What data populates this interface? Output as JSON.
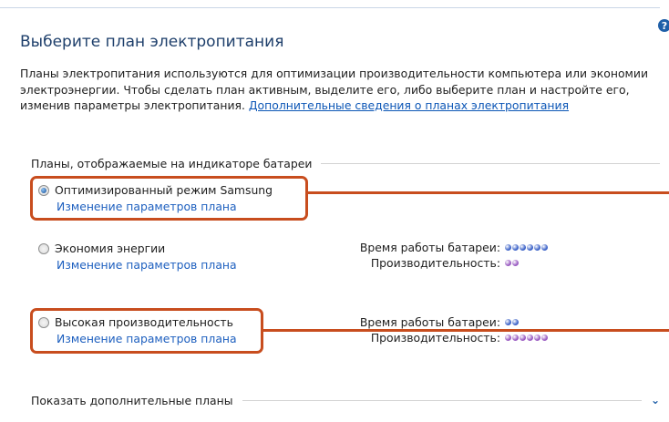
{
  "help_icon": "question-mark-icon",
  "title": "Выберите план электропитания",
  "description": {
    "text": "Планы электропитания используются для оптимизации производительности компьютера или экономии электроэнергии. Чтобы сделать план активным, выделите его, либо выберите план и настройте его, изменив параметры электропитания. ",
    "link": "Дополнительные сведения о планах электропитания"
  },
  "plans_group": {
    "label": "Планы, отображаемые на индикаторе батареи",
    "plans": [
      {
        "name": "Оптимизированный режим Samsung",
        "link": "Изменение параметров плана",
        "selected": true
      },
      {
        "name": "Экономия энергии",
        "link": "Изменение параметров плана",
        "selected": false,
        "battery_label": "Время работы батареи:",
        "performance_label": "Производительность:",
        "battery_dots": 6,
        "performance_dots": 2
      },
      {
        "name": "Высокая производительность",
        "link": "Изменение параметров плана",
        "selected": false,
        "battery_label": "Время работы батареи:",
        "performance_label": "Производительность:",
        "battery_dots": 2,
        "performance_dots": 6
      }
    ]
  },
  "more_plans": {
    "label": "Показать дополнительные планы",
    "icon": "chevron-down-icon"
  },
  "colors": {
    "highlight": "#c84d1e",
    "battery_dot": "#3d63c8",
    "performance_dot": "#9a5cc2",
    "link": "#1d5fbf"
  }
}
